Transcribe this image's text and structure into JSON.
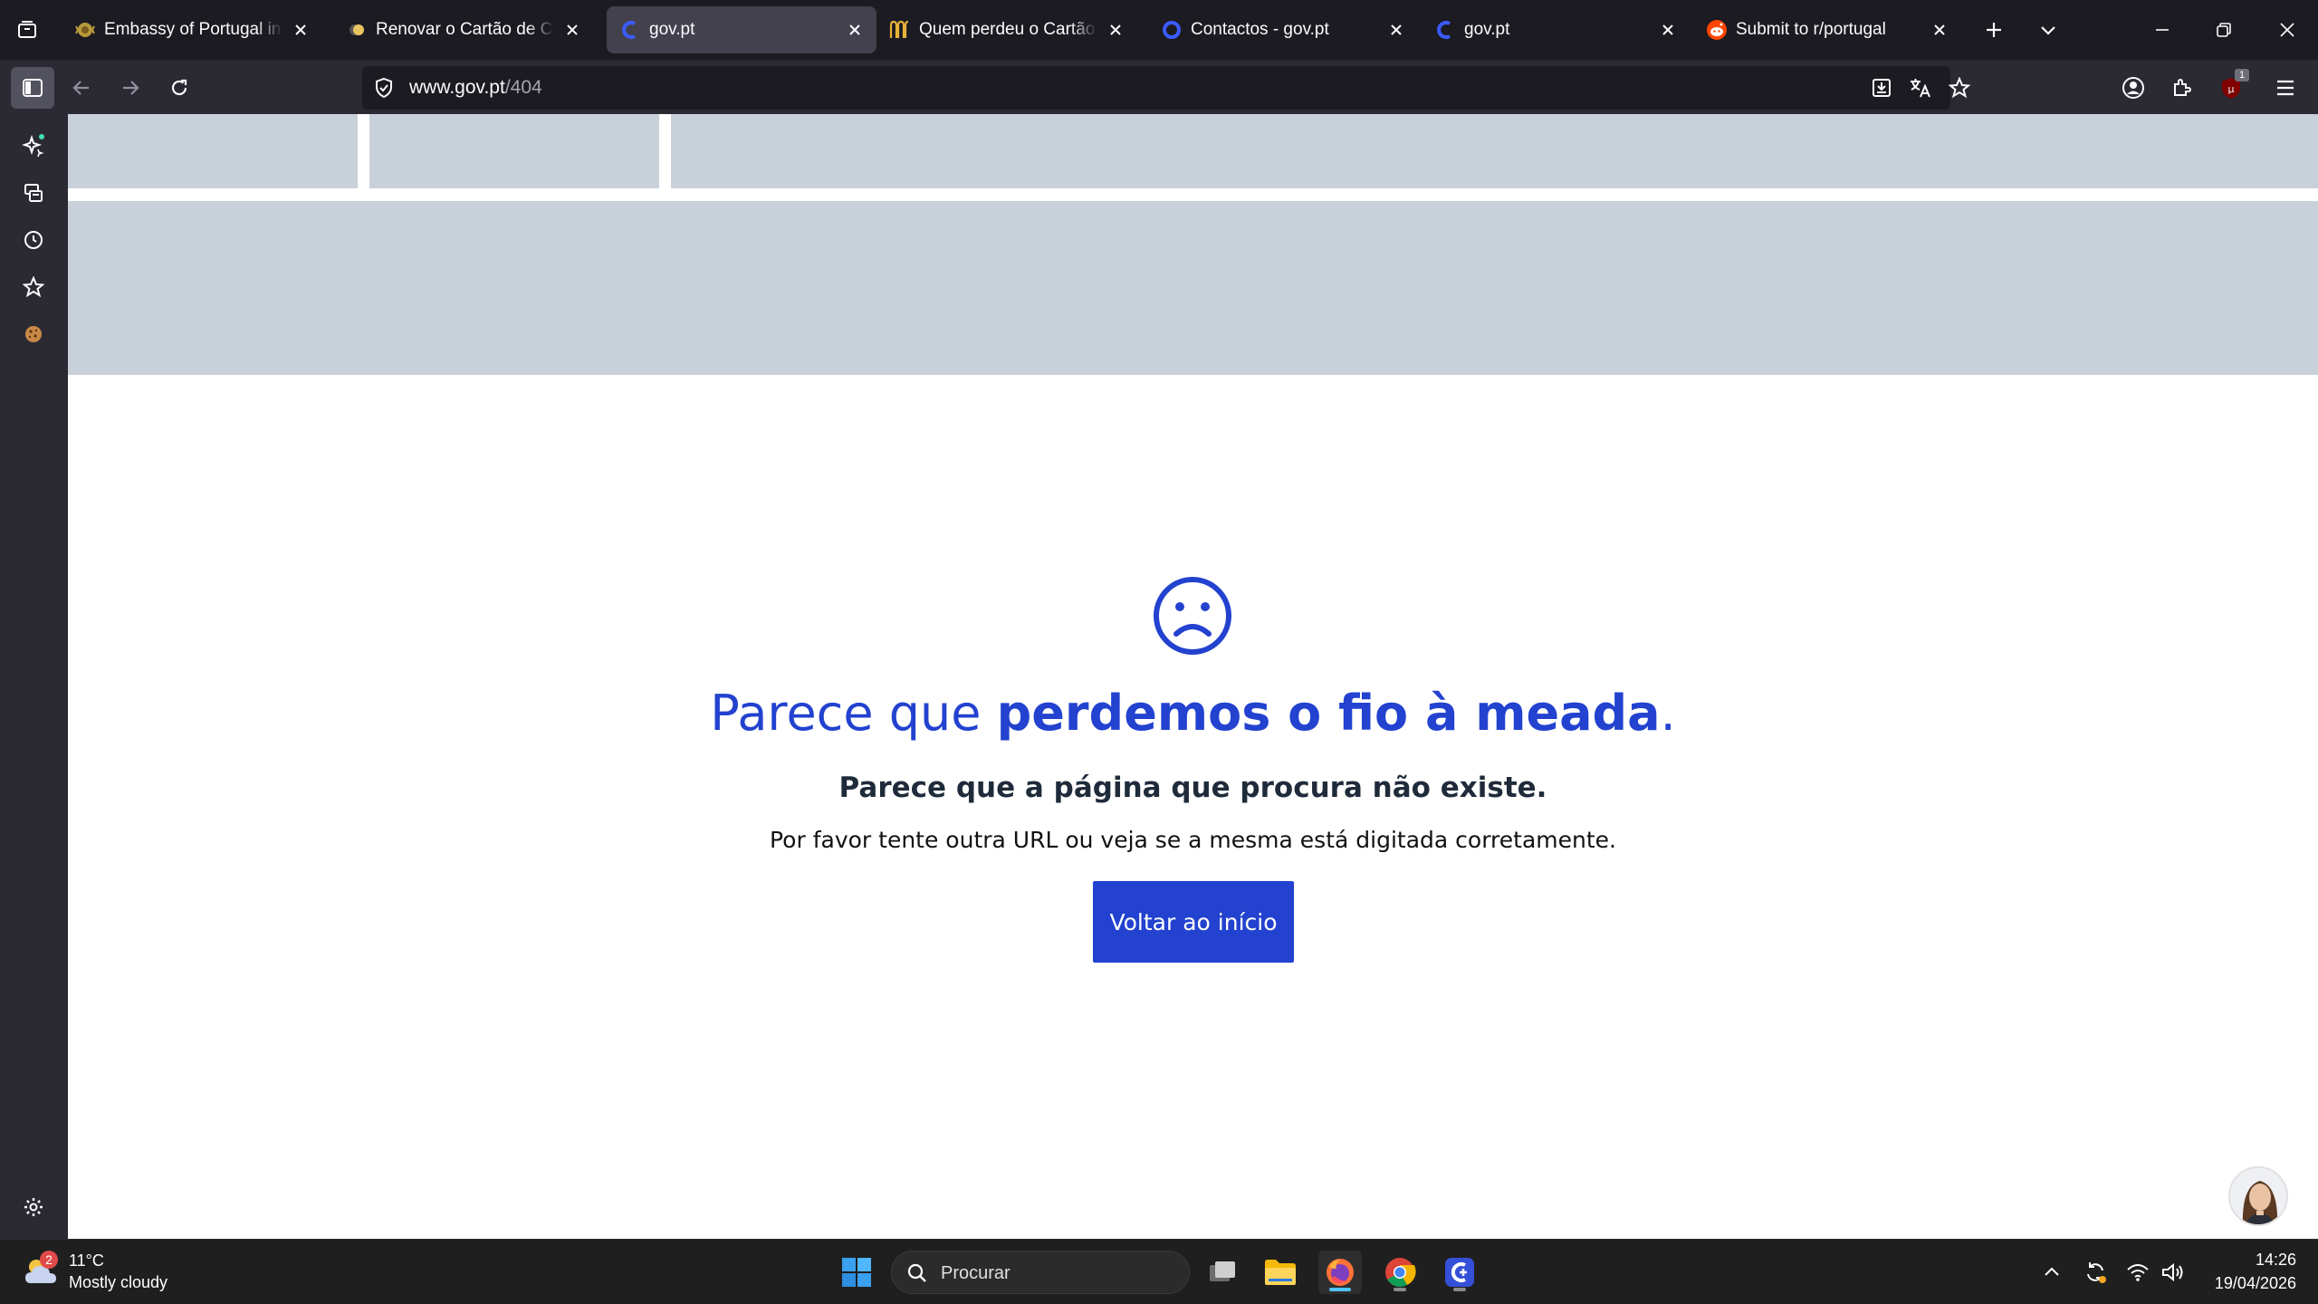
{
  "tabs": [
    {
      "title": "Embassy of Portugal in Ireland",
      "icon": "embassy-crest-icon",
      "active": false
    },
    {
      "title": "Renovar o Cartão de Cidadão",
      "icon": "coin-icon",
      "active": false
    },
    {
      "title": "gov.pt",
      "icon": "govpt-logo-icon",
      "active": true
    },
    {
      "title": "Quem perdeu o Cartão de Cidadão",
      "icon": "reclamacoes-icon",
      "active": false
    },
    {
      "title": "Contactos - gov.pt",
      "icon": "ring-icon",
      "active": false
    },
    {
      "title": "gov.pt",
      "icon": "govpt-logo-icon",
      "active": false
    },
    {
      "title": "Submit to r/portugal",
      "icon": "reddit-icon",
      "active": false
    }
  ],
  "urlbar": {
    "host": "www.gov.pt",
    "path": "/404"
  },
  "extensions": {
    "ublock_badge": "1"
  },
  "page": {
    "headline_light": "Parece que ",
    "headline_bold": "perdemos o fio à meada",
    "headline_end": ".",
    "subtitle": "Parece que a página que procura não existe.",
    "description": "Por favor tente outra URL ou veja se a mesma está digitada corretamente.",
    "button_label": "Voltar ao início"
  },
  "taskbar": {
    "weather_badge": "2",
    "temperature": "11°C",
    "weather_desc": "Mostly cloudy",
    "search_placeholder": "Procurar",
    "time": "14:26",
    "date": "19/04/2026"
  },
  "colors": {
    "brand_blue": "#2242cf",
    "skeleton": "#c8d0da",
    "browser_dark": "#1c1b22",
    "toolbar": "#2b2a33"
  }
}
